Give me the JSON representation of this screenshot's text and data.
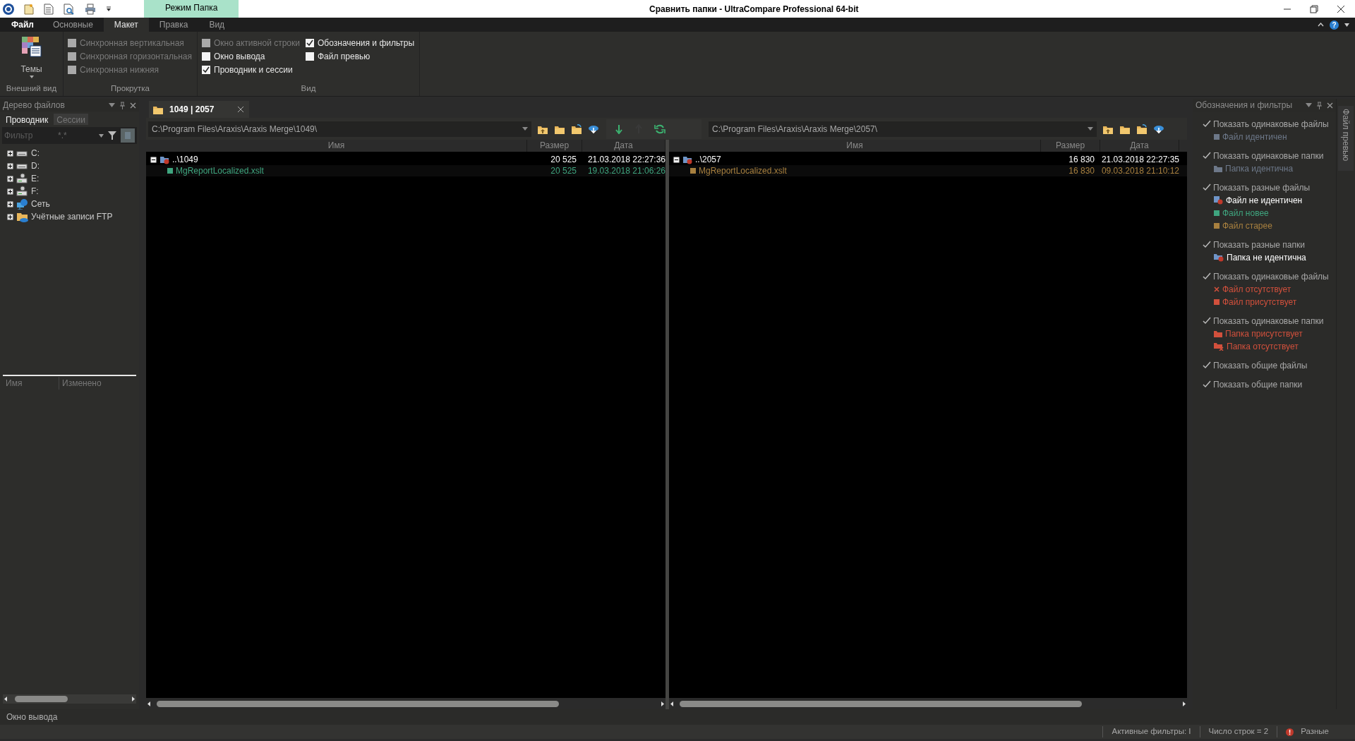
{
  "title_bar": {
    "title": "Сравнить папки - UltraCompare Professional 64-bit",
    "context_tab": "Режим Папка"
  },
  "ribbon": {
    "tabs": [
      {
        "label": "Файл",
        "selected": false,
        "kind": "menu"
      },
      {
        "label": "Основные",
        "selected": false,
        "kind": "tab"
      },
      {
        "label": "Макет",
        "selected": true,
        "kind": "tab"
      },
      {
        "label": "Правка",
        "selected": false,
        "kind": "tab"
      },
      {
        "label": "Вид",
        "selected": false,
        "kind": "tab"
      }
    ],
    "help": "?",
    "groups": [
      {
        "label": "Внешний вид",
        "kind": "button",
        "button": "Темы"
      },
      {
        "label": "Прокрутка",
        "kind": "checks",
        "columns": [
          [
            {
              "label": "Синхронная вертикальная",
              "checked": false,
              "disabled": true
            },
            {
              "label": "Синхронная горизонтальная",
              "checked": false,
              "disabled": true
            },
            {
              "label": "Синхронная нижняя",
              "checked": false,
              "disabled": true
            }
          ]
        ]
      },
      {
        "label": "Вид",
        "kind": "checks",
        "columns": [
          [
            {
              "label": "Окно активной строки",
              "checked": false,
              "disabled": true
            },
            {
              "label": "Окно вывода",
              "checked": false,
              "disabled": false
            },
            {
              "label": "Проводник и сессии",
              "checked": true,
              "disabled": false
            }
          ],
          [
            {
              "label": "Обозначения и фильтры",
              "checked": true,
              "disabled": false
            },
            {
              "label": "Файл превью",
              "checked": false,
              "disabled": false
            }
          ]
        ]
      }
    ]
  },
  "file_tree": {
    "title": "Дерево файлов",
    "tabs": [
      {
        "label": "Проводник",
        "selected": true
      },
      {
        "label": "Сессии",
        "selected": false
      }
    ],
    "filter": {
      "label": "Фильтр",
      "value": "*.*"
    },
    "items": [
      {
        "label": "C:",
        "kind": "drive",
        "expanded": false
      },
      {
        "label": "D:",
        "kind": "drive",
        "expanded": false
      },
      {
        "label": "E:",
        "kind": "netdrive",
        "expanded": false
      },
      {
        "label": "F:",
        "kind": "netdrive",
        "expanded": false
      },
      {
        "label": "Сеть",
        "kind": "network",
        "expanded": false
      },
      {
        "label": "Учётные записи FTP",
        "kind": "ftp",
        "expanded": false
      }
    ],
    "columns": [
      "Имя",
      "Изменено"
    ]
  },
  "compare": {
    "tab": "1049 | 2057",
    "panes": [
      {
        "path": "C:\\Program Files\\Araxis\\Araxis Merge\\1049\\",
        "columns": [
          "Имя",
          "Размер",
          "Дата"
        ],
        "rows": [
          {
            "name": "..\\1049",
            "size": "20 525",
            "date": "21.03.2018 22:27:36",
            "kind": "folder-diff",
            "expanded": true,
            "children": [
              {
                "name": "MgReportLocalized.xslt",
                "size": "20 525",
                "date": "19.03.2018 21:06:26",
                "kind": "newer"
              }
            ]
          }
        ]
      },
      {
        "path": "C:\\Program Files\\Araxis\\Araxis Merge\\2057\\",
        "columns": [
          "Имя",
          "Размер",
          "Дата"
        ],
        "rows": [
          {
            "name": "..\\2057",
            "size": "16 830",
            "date": "21.03.2018 22:27:35",
            "kind": "folder-diff",
            "expanded": true,
            "children": [
              {
                "name": "MgReportLocalized.xslt",
                "size": "16 830",
                "date": "09.03.2018 21:10:12",
                "kind": "older"
              }
            ]
          }
        ]
      }
    ]
  },
  "legend": {
    "title": "Обозначения и фильтры",
    "groups": [
      {
        "label": "Показать одинаковые файлы",
        "checked": true,
        "items": [
          {
            "label": "Файл идентичен",
            "kind": "square",
            "color": "#6d7889"
          }
        ]
      },
      {
        "label": "Показать одинаковые папки",
        "checked": true,
        "items": [
          {
            "label": "Папка идентична",
            "kind": "folder",
            "color": "#6d7889"
          }
        ]
      },
      {
        "label": "Показать разные файлы",
        "checked": true,
        "items": [
          {
            "label": "Файл не идентичен",
            "kind": "file-badge",
            "color": "#ffffff"
          },
          {
            "label": "Файл новее",
            "kind": "square",
            "color": "#3fa57f"
          },
          {
            "label": "Файл старее",
            "kind": "square",
            "color": "#a8803f"
          }
        ]
      },
      {
        "label": "Показать разные папки",
        "checked": true,
        "items": [
          {
            "label": "Папка не идентична",
            "kind": "folder-badge",
            "color": "#ffffff"
          }
        ]
      },
      {
        "label": "Показать одинаковые файлы",
        "checked": true,
        "items": [
          {
            "label": "Файл отсутствует",
            "kind": "cross",
            "color": "#d2503c"
          },
          {
            "label": "Файл присутствует",
            "kind": "square",
            "color": "#d2503c"
          }
        ]
      },
      {
        "label": "Показать одинаковые папки",
        "checked": true,
        "items": [
          {
            "label": "Папка присутствует",
            "kind": "folder",
            "color": "#d2503c"
          },
          {
            "label": "Папка отсутствует",
            "kind": "folder-cross",
            "color": "#d2503c"
          }
        ]
      },
      {
        "label": "Показать общие файлы",
        "checked": true
      },
      {
        "label": "Показать общие папки",
        "checked": true
      }
    ]
  },
  "side_tab": "Файл превью",
  "output_window": "Окно вывода",
  "status_bar": [
    {
      "text": "Активные фильтры: I",
      "kind": "text"
    },
    {
      "text": "Число строк = 2",
      "kind": "text"
    },
    {
      "text": "Разные",
      "kind": "alert"
    }
  ]
}
